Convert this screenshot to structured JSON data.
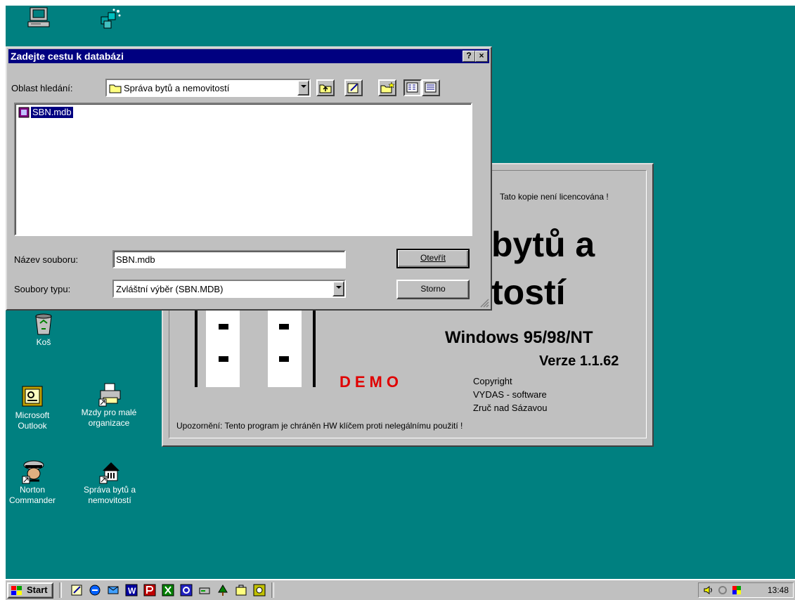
{
  "dialog": {
    "title": "Zadejte cestu k databázi",
    "help_button": "?",
    "close_button": "×",
    "look_in_label": "Oblast hledání:",
    "look_in_value": "Správa bytů a nemovitostí",
    "files": [
      {
        "name": "SBN.mdb",
        "selected": true
      }
    ],
    "filename_label": "Název souboru:",
    "filename_value": "SBN.mdb",
    "filetype_label": "Soubory typu:",
    "filetype_value": "Zvláštní výběr (SBN.MDB)",
    "open_button": "Otevřít",
    "cancel_button": "Storno"
  },
  "splash": {
    "license_notice": "Tato kopie není licencována !",
    "title_line1": "bytů a",
    "title_line2": "tostí",
    "platform": "Windows 95/98/NT",
    "version": "Verze 1.1.62",
    "demo": "DEMO",
    "copyright_1": "Copyright",
    "copyright_2": "VYDAS - software",
    "copyright_3": "Zruč nad Sázavou",
    "warning": "Upozornění: Tento program je chráněn HW klíčem proti nelegálnímu použití !"
  },
  "desktop_icons": [
    {
      "label": "Koš",
      "icon": "recycle-bin-icon"
    },
    {
      "label": "Microsoft Outlook",
      "icon": "outlook-icon"
    },
    {
      "label": "Mzdy pro malé organizace",
      "icon": "printer-shortcut-icon"
    },
    {
      "label": "Norton Commander",
      "icon": "norton-commander-icon"
    },
    {
      "label": "Správa bytů a nemovitostí",
      "icon": "house-shortcut-icon"
    }
  ],
  "taskbar": {
    "start_label": "Start",
    "clock": "13:48"
  },
  "colors": {
    "desktop": "#008080",
    "titlebar": "#000080",
    "face": "#c0c0c0",
    "demo_red": "#e00000"
  }
}
